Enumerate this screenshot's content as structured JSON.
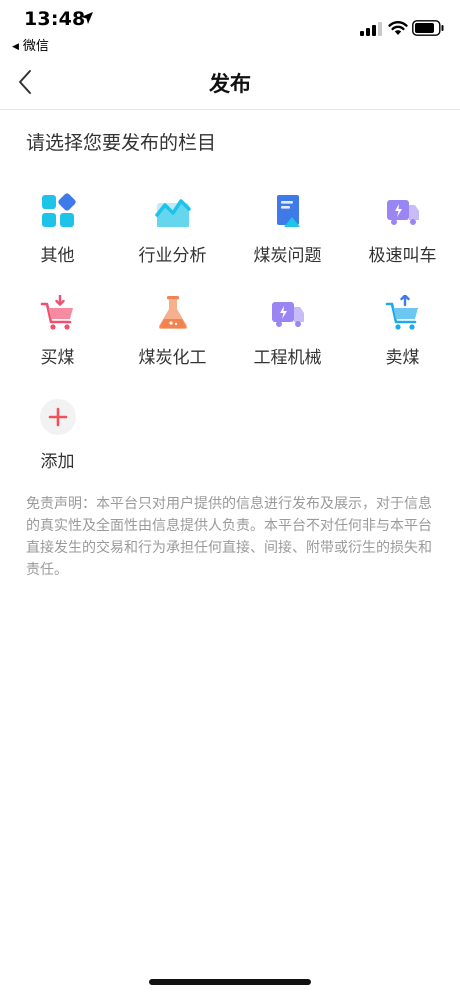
{
  "status_bar": {
    "time": "13:48",
    "back_app_label": "微信"
  },
  "nav": {
    "title": "发布",
    "back_icon": "chevron-left-icon"
  },
  "section_title": "请选择您要发布的栏目",
  "categories": [
    {
      "label": "其他",
      "icon": "apps-grid-icon"
    },
    {
      "label": "行业分析",
      "icon": "line-chart-icon"
    },
    {
      "label": "煤炭问题",
      "icon": "document-icon"
    },
    {
      "label": "极速叫车",
      "icon": "truck-icon"
    },
    {
      "label": "买煤",
      "icon": "cart-in-icon"
    },
    {
      "label": "煤炭化工",
      "icon": "flask-icon"
    },
    {
      "label": "工程机械",
      "icon": "truck-icon"
    },
    {
      "label": "卖煤",
      "icon": "cart-out-icon"
    },
    {
      "label": "添加",
      "icon": "plus-icon"
    }
  ],
  "disclaimer": "免责声明：本平台只对用户提供的信息进行发布及展示，对于信息的真实性及全面性由信息提供人负责。本平台不对任何非与本平台直接发生的交易和行为承担任何直接、间接、附带或衍生的损失和责任。",
  "colors": {
    "cyan_icon": "#1ec3e8",
    "blue_icon": "#3f7be8",
    "purple_icon": "#9a86f2",
    "red_icon": "#f0506e",
    "orange_icon": "#f28350",
    "plus_red": "#f0505a",
    "disclaimer_text": "#9a9a9a"
  }
}
